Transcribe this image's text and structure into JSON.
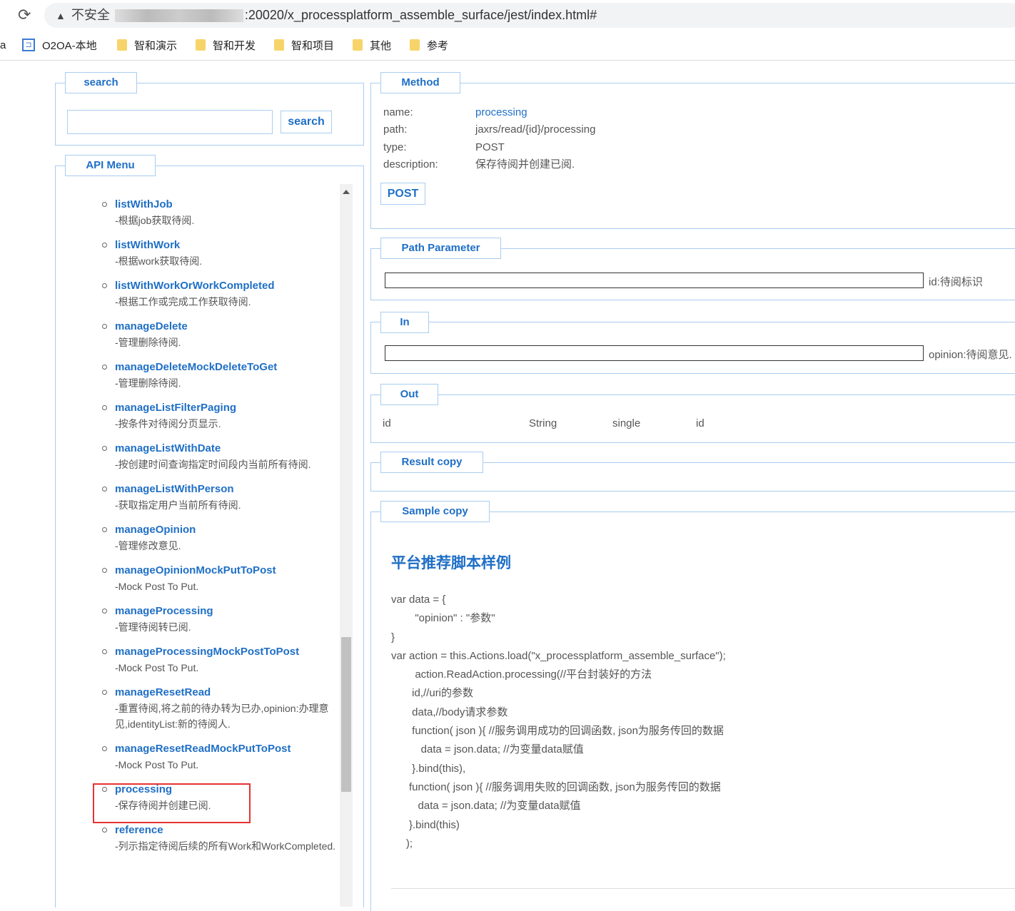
{
  "browser": {
    "insecure_label": "不安全",
    "url_suffix": ":20020/x_processplatform_assemble_surface/jest/index.html#",
    "bookmarks": [
      {
        "label": "O2OA-本地",
        "icon": "o2-icon"
      },
      {
        "label": "智和演示",
        "icon": "folder-icon"
      },
      {
        "label": "智和开发",
        "icon": "folder-icon"
      },
      {
        "label": "智和项目",
        "icon": "folder-icon"
      },
      {
        "label": "其他",
        "icon": "folder-icon"
      },
      {
        "label": "参考",
        "icon": "folder-icon"
      }
    ],
    "bookmark_cut": "a"
  },
  "search": {
    "legend": "search",
    "value": "",
    "button": "search"
  },
  "menu": {
    "legend": "API Menu",
    "items": [
      {
        "name": "listWithJob",
        "desc": "-根据job获取待阅."
      },
      {
        "name": "listWithWork",
        "desc": "-根据work获取待阅."
      },
      {
        "name": "listWithWorkOrWorkCompleted",
        "desc": "-根据工作或完成工作获取待阅."
      },
      {
        "name": "manageDelete",
        "desc": "-管理删除待阅."
      },
      {
        "name": "manageDeleteMockDeleteToGet",
        "desc": "-管理删除待阅."
      },
      {
        "name": "manageListFilterPaging",
        "desc": "-按条件对待阅分页显示."
      },
      {
        "name": "manageListWithDate",
        "desc": "-按创建时间查询指定时间段内当前所有待阅."
      },
      {
        "name": "manageListWithPerson",
        "desc": "-获取指定用户当前所有待阅."
      },
      {
        "name": "manageOpinion",
        "desc": "-管理修改意见."
      },
      {
        "name": "manageOpinionMockPutToPost",
        "desc": "-Mock Post To Put."
      },
      {
        "name": "manageProcessing",
        "desc": "-管理待阅转已阅."
      },
      {
        "name": "manageProcessingMockPostToPost",
        "desc": "-Mock Post To Put."
      },
      {
        "name": "manageResetRead",
        "desc": "-重置待阅,将之前的待办转为已办,opinion:办理意见,identityList:新的待阅人."
      },
      {
        "name": "manageResetReadMockPutToPost",
        "desc": "-Mock Post To Put."
      },
      {
        "name": "processing",
        "desc": "-保存待阅并创建已阅."
      },
      {
        "name": "reference",
        "desc": "-列示指定待阅后续的所有Work和WorkCompleted."
      }
    ],
    "selected": "processing"
  },
  "method": {
    "legend": "Method",
    "name_label": "name:",
    "name": "processing",
    "path_label": "path:",
    "path": "jaxrs/read/{id}/processing",
    "type_label": "type:",
    "type": "POST",
    "desc_label": "description:",
    "desc": "保存待阅并创建已阅.",
    "button": "POST"
  },
  "path_param": {
    "legend": "Path Parameter",
    "value": "",
    "label": "id:待阅标识"
  },
  "in": {
    "legend": "In",
    "value": "",
    "label": "opinion:待阅意见."
  },
  "out": {
    "legend": "Out",
    "row": [
      "id",
      "String",
      "single",
      "id"
    ]
  },
  "result": {
    "legend": "Result copy"
  },
  "sample": {
    "legend": "Sample copy",
    "title": "平台推荐脚本样例",
    "code": "var data = {\n        \"opinion\" : \"参数\"\n}\nvar action = this.Actions.load(\"x_processplatform_assemble_surface\");\n        action.ReadAction.processing(//平台封装好的方法\n       id,//uri的参数\n       data,//body请求参数\n       function( json ){ //服务调用成功的回调函数, json为服务传回的数据\n          data = json.data; //为变量data赋值\n       }.bind(this),\n      function( json ){ //服务调用失败的回调函数, json为服务传回的数据\n         data = json.data; //为变量data赋值\n      }.bind(this)\n     );"
  },
  "colors": {
    "accent": "#1f6fc6",
    "border": "#a9cdf0",
    "highlight": "#e53333"
  }
}
